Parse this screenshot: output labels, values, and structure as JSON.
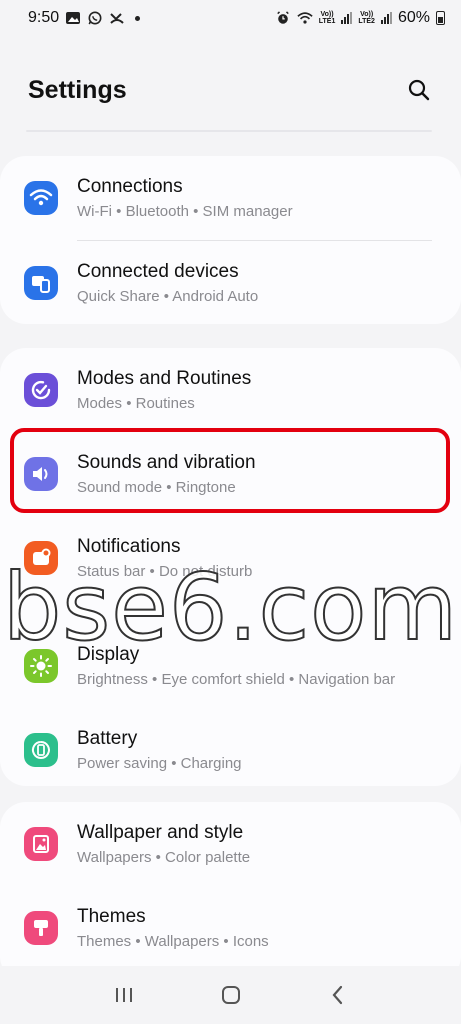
{
  "status_bar": {
    "time": "9:50",
    "battery_percent": "60%",
    "sim1_label": "VoLTE1",
    "sim2_label": "VoLTE2"
  },
  "header": {
    "title": "Settings"
  },
  "colors": {
    "connections": "#2a73e8",
    "connected_devices": "#2a73e8",
    "modes": "#6b4fd8",
    "sounds": "#6f72e6",
    "notifications": "#f25c22",
    "display": "#7bc72b",
    "battery": "#2cbf8c",
    "wallpaper": "#ef4a7c",
    "themes": "#ef4a7c",
    "highlight": "#e3000f"
  },
  "settings": [
    {
      "title": "Connections",
      "subtitle": "Wi-Fi  •  Bluetooth  •  SIM manager",
      "icon": "wifi-icon"
    },
    {
      "title": "Connected devices",
      "subtitle": "Quick Share  •  Android Auto",
      "icon": "devices-icon"
    },
    {
      "title": "Modes and Routines",
      "subtitle": "Modes  •  Routines",
      "icon": "check-circle-icon"
    },
    {
      "title": "Sounds and vibration",
      "subtitle": "Sound mode  •  Ringtone",
      "icon": "speaker-icon"
    },
    {
      "title": "Notifications",
      "subtitle": "Status bar  •  Do not disturb",
      "icon": "notification-icon"
    },
    {
      "title": "Display",
      "subtitle": "Brightness  •  Eye comfort shield  •  Navigation bar",
      "icon": "sun-icon"
    },
    {
      "title": "Battery",
      "subtitle": "Power saving  •  Charging",
      "icon": "battery-icon"
    },
    {
      "title": "Wallpaper and style",
      "subtitle": "Wallpapers  •  Color palette",
      "icon": "wallpaper-icon"
    },
    {
      "title": "Themes",
      "subtitle": "Themes  •  Wallpapers  •  Icons",
      "icon": "themes-icon"
    }
  ],
  "watermark": "bse6.com"
}
